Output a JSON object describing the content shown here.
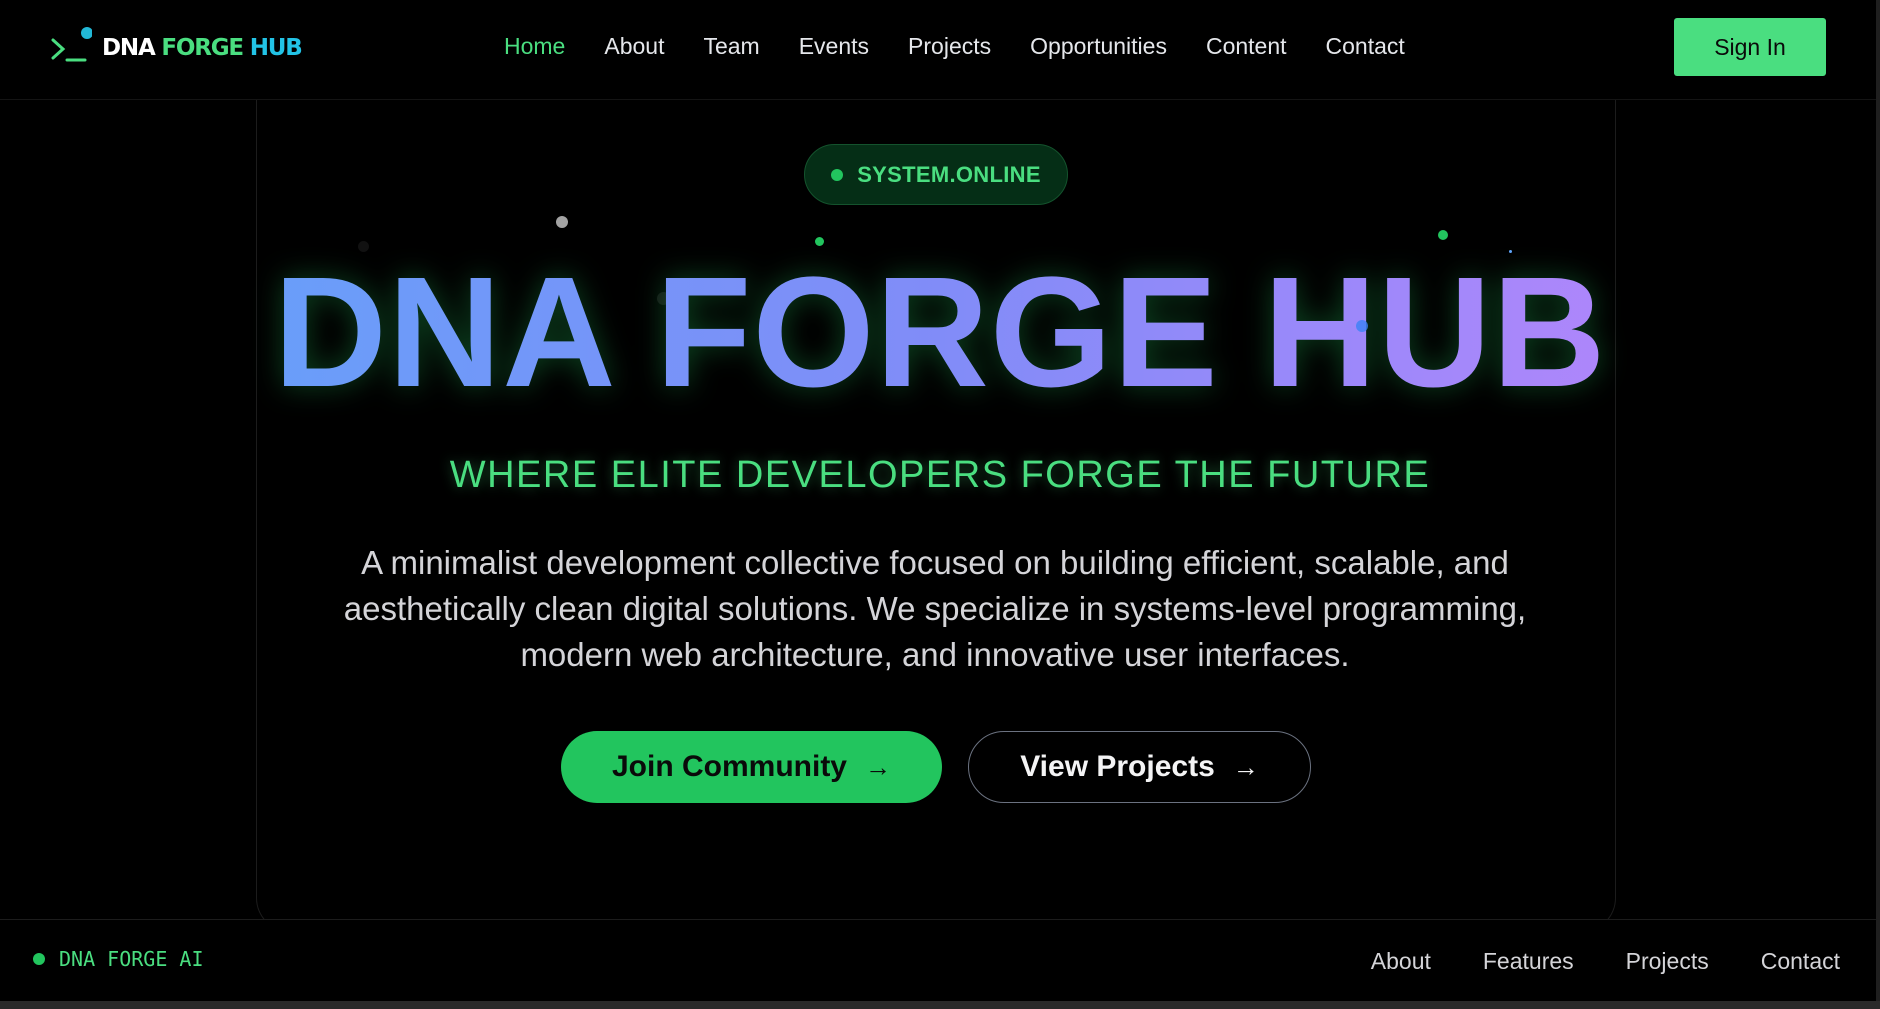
{
  "brand": {
    "logo_word1": "DNA",
    "logo_word2": "FORGE",
    "logo_word3": "HUB"
  },
  "nav": {
    "items": [
      {
        "label": "Home",
        "active": true
      },
      {
        "label": "About"
      },
      {
        "label": "Team"
      },
      {
        "label": "Events"
      },
      {
        "label": "Projects"
      },
      {
        "label": "Opportunities"
      },
      {
        "label": "Content"
      },
      {
        "label": "Contact"
      }
    ],
    "signin_label": "Sign In"
  },
  "hero": {
    "status_badge": "SYSTEM.ONLINE",
    "title": "DNA FORGE HUB",
    "tagline": "WHERE ELITE DEVELOPERS FORGE THE FUTURE",
    "description": "A minimalist development collective focused on building efficient, scalable, and aesthetically clean digital solutions. We specialize in systems-level programming, modern web architecture, and innovative user interfaces.",
    "join_label": "Join Community",
    "view_label": "View Projects",
    "arrow_icon": "arrow-right-icon"
  },
  "footer": {
    "brand": "DNA FORGE AI",
    "links": [
      "About",
      "Features",
      "Projects",
      "Contact"
    ]
  },
  "colors": {
    "accent_green": "#4ade80",
    "button_green": "#22c55e",
    "gradient_start": "#60a5fa",
    "gradient_end": "#c084fc",
    "background": "#000000"
  }
}
